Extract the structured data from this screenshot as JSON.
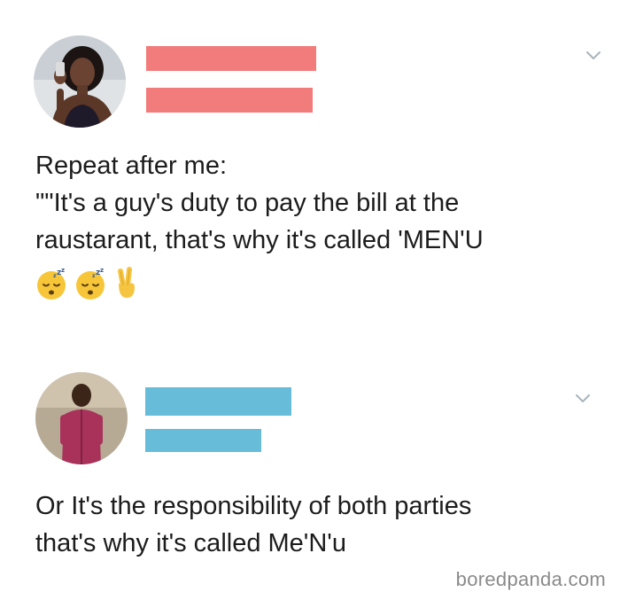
{
  "posts": [
    {
      "avatar": "profile-photo-woman",
      "redaction_color": "#f27b7b",
      "text_lines": [
        "Repeat after me:",
        "\"\"It's a guy's duty to pay the bill at the",
        "raustarant, that's why it's called 'MEN'U"
      ],
      "emojis": [
        "sleeping-face-icon",
        "sleeping-face-icon",
        "victory-hand-icon"
      ]
    },
    {
      "avatar": "profile-photo-man",
      "redaction_color": "#67bcd9",
      "text_lines": [
        "Or It's the responsibility of both parties",
        "that's why it's called Me'N'u"
      ]
    }
  ],
  "watermark": "boredpanda.com"
}
